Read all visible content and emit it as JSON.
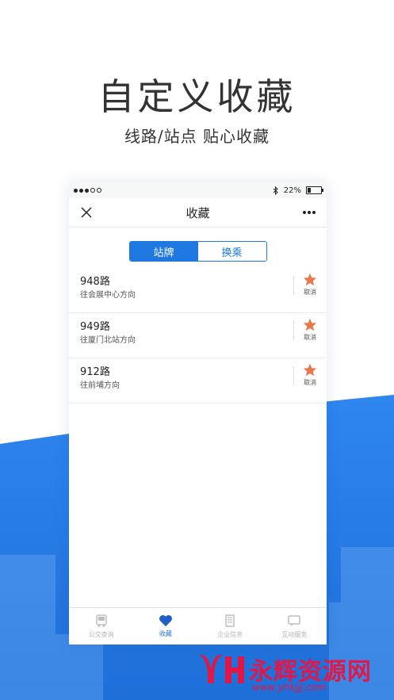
{
  "headline": "自定义收藏",
  "subline": "线路/站点   贴心收藏",
  "status": {
    "battery": "22%"
  },
  "navbar": {
    "title": "收藏"
  },
  "segment": {
    "tab1": "站牌",
    "tab2": "换乘"
  },
  "favorites": [
    {
      "route": "948路",
      "direction": "往会展中心方向",
      "action": "取消"
    },
    {
      "route": "949路",
      "direction": "往厦门北站方向",
      "action": "取消"
    },
    {
      "route": "912路",
      "direction": "往前埔方向",
      "action": "取消"
    }
  ],
  "tabbar": [
    {
      "label": "公交查询",
      "icon": "bus-icon"
    },
    {
      "label": "收藏",
      "icon": "heart-icon"
    },
    {
      "label": "企业信息",
      "icon": "building-icon"
    },
    {
      "label": "互动服务",
      "icon": "chat-icon"
    }
  ],
  "watermark": {
    "text": "永辉资源网",
    "url": "www.yhkjjj.com"
  },
  "colors": {
    "accent": "#1f77e0",
    "star": "#e8784a",
    "watermark": "#e0184a"
  }
}
